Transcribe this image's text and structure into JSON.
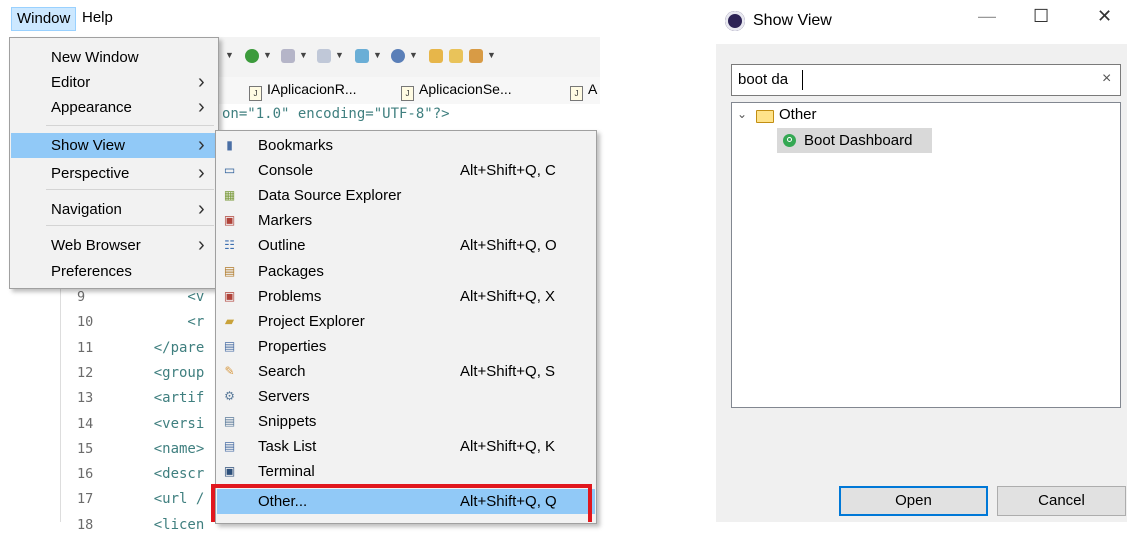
{
  "menubar": {
    "window": "Window",
    "help": "Help"
  },
  "editor_tabs": [
    "IAplicacionR...",
    "AplicacionSe...",
    "A"
  ],
  "xml_decl": "on=\"1.0\" encoding=\"UTF-8\"?>",
  "code_lines": [
    {
      "n": "9",
      "text": "        <v"
    },
    {
      "n": "10",
      "text": "        <r"
    },
    {
      "n": "11",
      "text": "    </pare"
    },
    {
      "n": "12",
      "text": "    <group"
    },
    {
      "n": "13",
      "text": "    <artif"
    },
    {
      "n": "14",
      "text": "    <versi"
    },
    {
      "n": "15",
      "text": "    <name>"
    },
    {
      "n": "16",
      "text": "    <descr"
    },
    {
      "n": "17",
      "text": "    <url /"
    },
    {
      "n": "18",
      "text": "    <licen"
    }
  ],
  "window_menu": {
    "items": [
      {
        "label": "New Window",
        "submenu": false
      },
      {
        "label": "Editor",
        "submenu": true
      },
      {
        "label": "Appearance",
        "submenu": true
      },
      {
        "label": "Show View",
        "submenu": true,
        "highlighted": true
      },
      {
        "label": "Perspective",
        "submenu": true
      },
      {
        "label": "Navigation",
        "submenu": true
      },
      {
        "label": "Web Browser",
        "submenu": true
      },
      {
        "label": "Preferences",
        "submenu": false
      }
    ]
  },
  "show_view_menu": {
    "items": [
      {
        "label": "Bookmarks",
        "accel": "",
        "icon": "bookmarks-icon"
      },
      {
        "label": "Console",
        "accel": "Alt+Shift+Q, C",
        "icon": "console-icon"
      },
      {
        "label": "Data Source Explorer",
        "accel": "",
        "icon": "data-source-icon"
      },
      {
        "label": "Markers",
        "accel": "",
        "icon": "markers-icon"
      },
      {
        "label": "Outline",
        "accel": "Alt+Shift+Q, O",
        "icon": "outline-icon"
      },
      {
        "label": "Packages",
        "accel": "",
        "icon": "packages-icon"
      },
      {
        "label": "Problems",
        "accel": "Alt+Shift+Q, X",
        "icon": "problems-icon"
      },
      {
        "label": "Project Explorer",
        "accel": "",
        "icon": "project-explorer-icon"
      },
      {
        "label": "Properties",
        "accel": "",
        "icon": "properties-icon"
      },
      {
        "label": "Search",
        "accel": "Alt+Shift+Q, S",
        "icon": "search-icon"
      },
      {
        "label": "Servers",
        "accel": "",
        "icon": "servers-icon"
      },
      {
        "label": "Snippets",
        "accel": "",
        "icon": "snippets-icon"
      },
      {
        "label": "Task List",
        "accel": "Alt+Shift+Q, K",
        "icon": "task-list-icon"
      },
      {
        "label": "Terminal",
        "accel": "",
        "icon": "terminal-icon"
      },
      {
        "label": "Other...",
        "accel": "Alt+Shift+Q, Q",
        "icon": "",
        "highlighted": true
      }
    ]
  },
  "dialog": {
    "title": "Show View",
    "search_value": "boot da",
    "clear_symbol": "×",
    "tree_category": "Other",
    "tree_item": "Boot Dashboard",
    "open_label": "Open",
    "cancel_label": "Cancel",
    "minimize": "—",
    "maximize": "☐",
    "close": "✕"
  },
  "colors": {
    "menu_highlight": "#91c9f7",
    "callout_red": "#e1171e",
    "default_button_border": "#0078d7"
  }
}
